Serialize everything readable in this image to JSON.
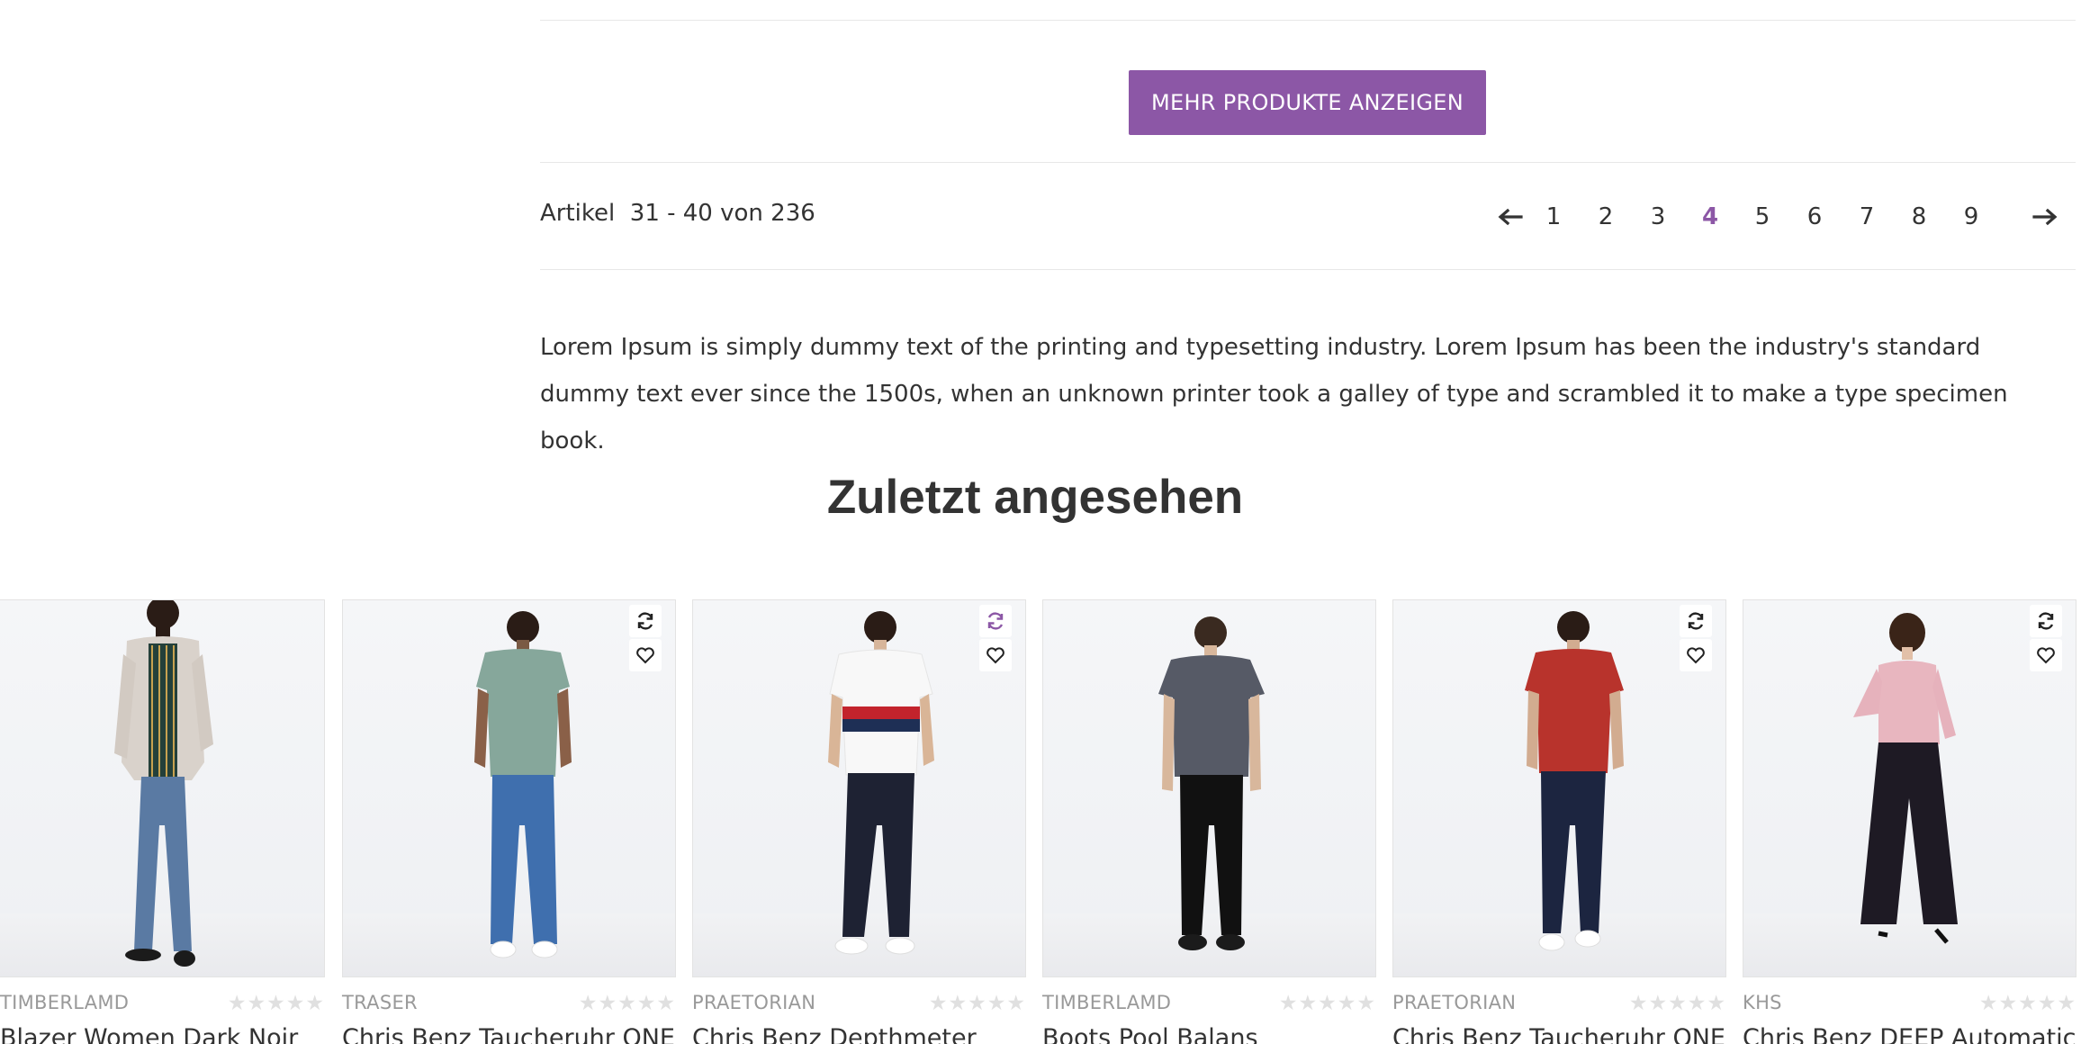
{
  "load_more": {
    "label": "MEHR PRODUKTE ANZEIGEN"
  },
  "pagination": {
    "summary": "Artikel  31 - 40 von 236",
    "pages": [
      "1",
      "2",
      "3",
      "4",
      "5",
      "6",
      "7",
      "8",
      "9"
    ],
    "active_page": "4",
    "prev_icon": "arrow-left-icon",
    "next_icon": "arrow-right-icon"
  },
  "description": "Lorem Ipsum is simply dummy text of the printing and typesetting industry. Lorem Ipsum has been the industry's standard dummy text ever since the 1500s, when an unknown printer took a galley of type and scrambled it to make a type specimen book.",
  "recently_viewed": {
    "title": "Zuletzt angesehen",
    "products": [
      {
        "brand": "TIMBERLAMD",
        "name": "Blazer Women Dark Noir",
        "rating": 0,
        "compare_active": false
      },
      {
        "brand": "TRASER",
        "name": "Chris Benz Taucheruhr ONE",
        "rating": 0,
        "compare_active": false
      },
      {
        "brand": "PRAETORIAN",
        "name": "Chris Benz Depthmeter",
        "rating": 0,
        "compare_active": true
      },
      {
        "brand": "TIMBERLAMD",
        "name": "Boots Pool Balans",
        "rating": 0,
        "compare_active": false
      },
      {
        "brand": "PRAETORIAN",
        "name": "Chris Benz Taucheruhr ONE",
        "rating": 0,
        "compare_active": false
      },
      {
        "brand": "KHS",
        "name": "Chris Benz DEEP Automatic",
        "rating": 0,
        "compare_active": false
      }
    ]
  },
  "colors": {
    "accent": "#8c57a6",
    "text": "#333333",
    "muted": "#999999",
    "star_empty": "#e0e0e0"
  }
}
